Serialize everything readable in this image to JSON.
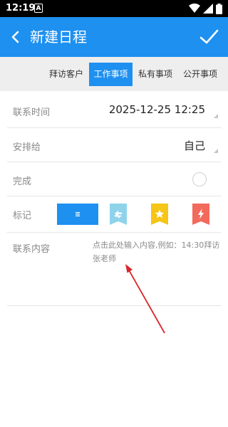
{
  "status_bar": {
    "time": "12:19",
    "notification_badge": "A",
    "icons": [
      "wifi-icon",
      "signal-icon",
      "battery-icon"
    ]
  },
  "app_bar": {
    "title": "新建日程",
    "back_icon": "arrow-left-icon",
    "confirm_icon": "check-icon",
    "background_color": "#1e90f0"
  },
  "tabs": [
    {
      "label": "拜访客户",
      "active": false
    },
    {
      "label": "工作事项",
      "active": true
    },
    {
      "label": "私有事项",
      "active": false
    },
    {
      "label": "公开事项",
      "active": false
    }
  ],
  "form": {
    "contact_time": {
      "label": "联系时间",
      "value": "2025-12-25 12:25"
    },
    "assign_to": {
      "label": "安排给",
      "value": "自己"
    },
    "done": {
      "label": "完成",
      "checked": false
    },
    "mark": {
      "label": "标记",
      "options": [
        {
          "icon": "list-icon",
          "color": "#1e90f0",
          "selected": true
        },
        {
          "icon": "swap-icon",
          "color": "#8fd3ea",
          "selected": false
        },
        {
          "icon": "star-icon",
          "color": "#f5c518",
          "selected": false
        },
        {
          "icon": "lightning-icon",
          "color": "#f26a5b",
          "selected": false
        }
      ]
    },
    "content": {
      "label": "联系内容",
      "placeholder": "点击此处输入内容,例如：14:30拜访张老师"
    }
  },
  "annotation": {
    "color": "#d9262a"
  }
}
